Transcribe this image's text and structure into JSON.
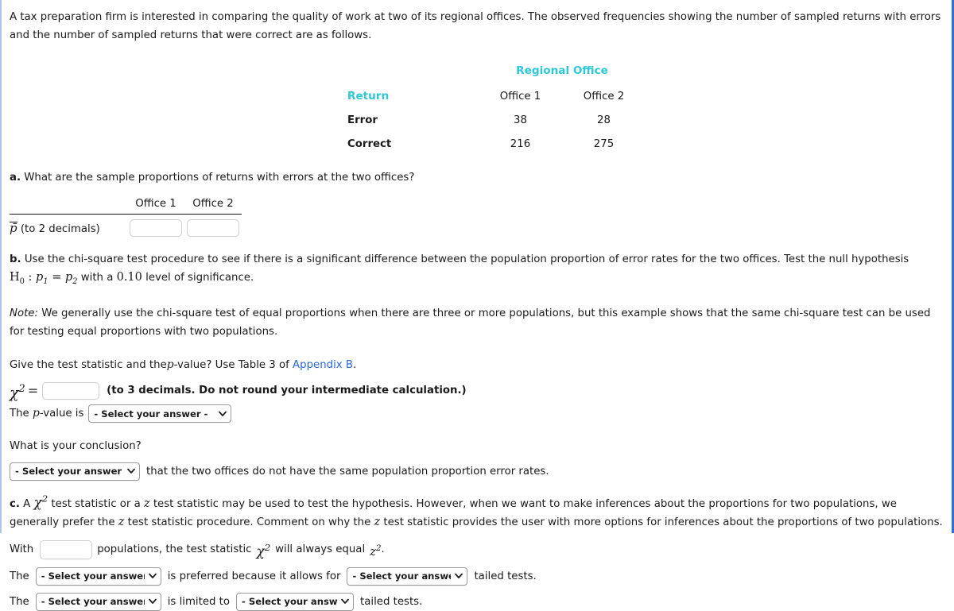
{
  "intro": {
    "text": "A tax preparation firm is interested in comparing the quality of work at two of its regional offices. The observed frequencies showing the number of sampled returns with errors and the number of sampled returns that were correct are as follows."
  },
  "observed_table": {
    "group_header": "Regional Office",
    "row_header": "Return",
    "columns": [
      "Office 1",
      "Office 2"
    ],
    "rows": [
      {
        "label": "Error",
        "values": [
          "38",
          "28"
        ]
      },
      {
        "label": "Correct",
        "values": [
          "216",
          "275"
        ]
      }
    ],
    "header_color": "#2ec8d6"
  },
  "part_a": {
    "question": "What are the sample proportions of returns with errors at the two offices?",
    "marker": "a.",
    "table": {
      "columns": [
        "Office 1",
        "Office 2"
      ],
      "row_label_symbol": "p̄",
      "row_label_rest": "(to 2 decimals)",
      "inputs": [
        {
          "value": "",
          "placeholder": ""
        },
        {
          "value": "",
          "placeholder": ""
        }
      ]
    }
  },
  "part_b": {
    "marker": "b.",
    "text_before_math": "Use the chi-square test procedure to see if there is a significant difference between the population proportion of error rates for the two offices. Test the null hypothesis",
    "hypothesis": "H0 : p1 = p2",
    "hypothesis_parts": {
      "H": "H",
      "H_sub": "0",
      "colon": " : ",
      "p1": "p",
      "p1_sub": "1",
      "equals": " = ",
      "p2": "p",
      "p2_sub": "2"
    },
    "text_after_math_1": "with a",
    "significance_level": "0.10",
    "text_after_math_2": "level of significance.",
    "note_label": "Note:",
    "note_text": "We generally use the chi-square test of equal proportions when there are three or more populations, but this example shows that the same chi-square test can be used for testing equal proportions with two populations.",
    "give_prefix": "Give the test statistic and the",
    "give_p": "p",
    "give_mid": "-value? Use Table 3 of",
    "appendix_link": "Appendix B",
    "give_suffix": ".",
    "chi_symbol": "χ",
    "chi_exponent": "2",
    "chi_equals": "=",
    "chi_input": {
      "value": "",
      "placeholder": ""
    },
    "chi_hint": "(to 3 decimals. Do not round your intermediate calculation.)",
    "pvalue_prefix": "The",
    "pvalue_p": "p",
    "pvalue_suffix": "-value is",
    "pvalue_select": "- Select your answer -"
  },
  "conclusion": {
    "question": "What is your conclusion?",
    "select": "- Select your answer -",
    "after_text": "that the two offices do not have the same population proportion error rates."
  },
  "part_c": {
    "marker": "c.",
    "text_1": "A",
    "chi_symbol": "χ",
    "chi_exponent": "2",
    "text_2": "test statistic or a",
    "z_symbol": "z",
    "text_3": "test statistic may be used to test the hypothesis. However, when we want to make inferences about the proportions for two populations, we generally prefer the",
    "z_symbol_2": "z",
    "text_4": "test statistic procedure. Comment on why the",
    "z_symbol_3": "z",
    "text_5": "test statistic provides the user with more options for inferences about the proportions of two populations.",
    "with_prefix": "With",
    "with_input": {
      "value": "",
      "placeholder": ""
    },
    "with_mid": "populations, the test statistic",
    "with_chi": "χ",
    "with_chi_exp": "2",
    "with_mid_2": "will always equal",
    "with_z": "z",
    "with_z_exp": "2",
    "with_period": ".",
    "pref_line": {
      "the_1": "The",
      "select_1": "- Select your answer -",
      "mid": "is preferred because it allows for",
      "select_2": "- Select your answer -",
      "tail": "tailed tests."
    },
    "limit_line": {
      "the_1": "The",
      "select_1": "- Select your answer -",
      "mid": "is limited to",
      "select_2": "- Select your answer -",
      "tail": "tailed tests."
    }
  },
  "theme": {
    "teal": "#2ec8d6",
    "link_blue": "#2a6ad4",
    "border_left": "#a9c6ef",
    "border_right": "#2f6fdc",
    "text": "#1b1b1b"
  },
  "icons": {
    "chevron_down": "⌄"
  }
}
